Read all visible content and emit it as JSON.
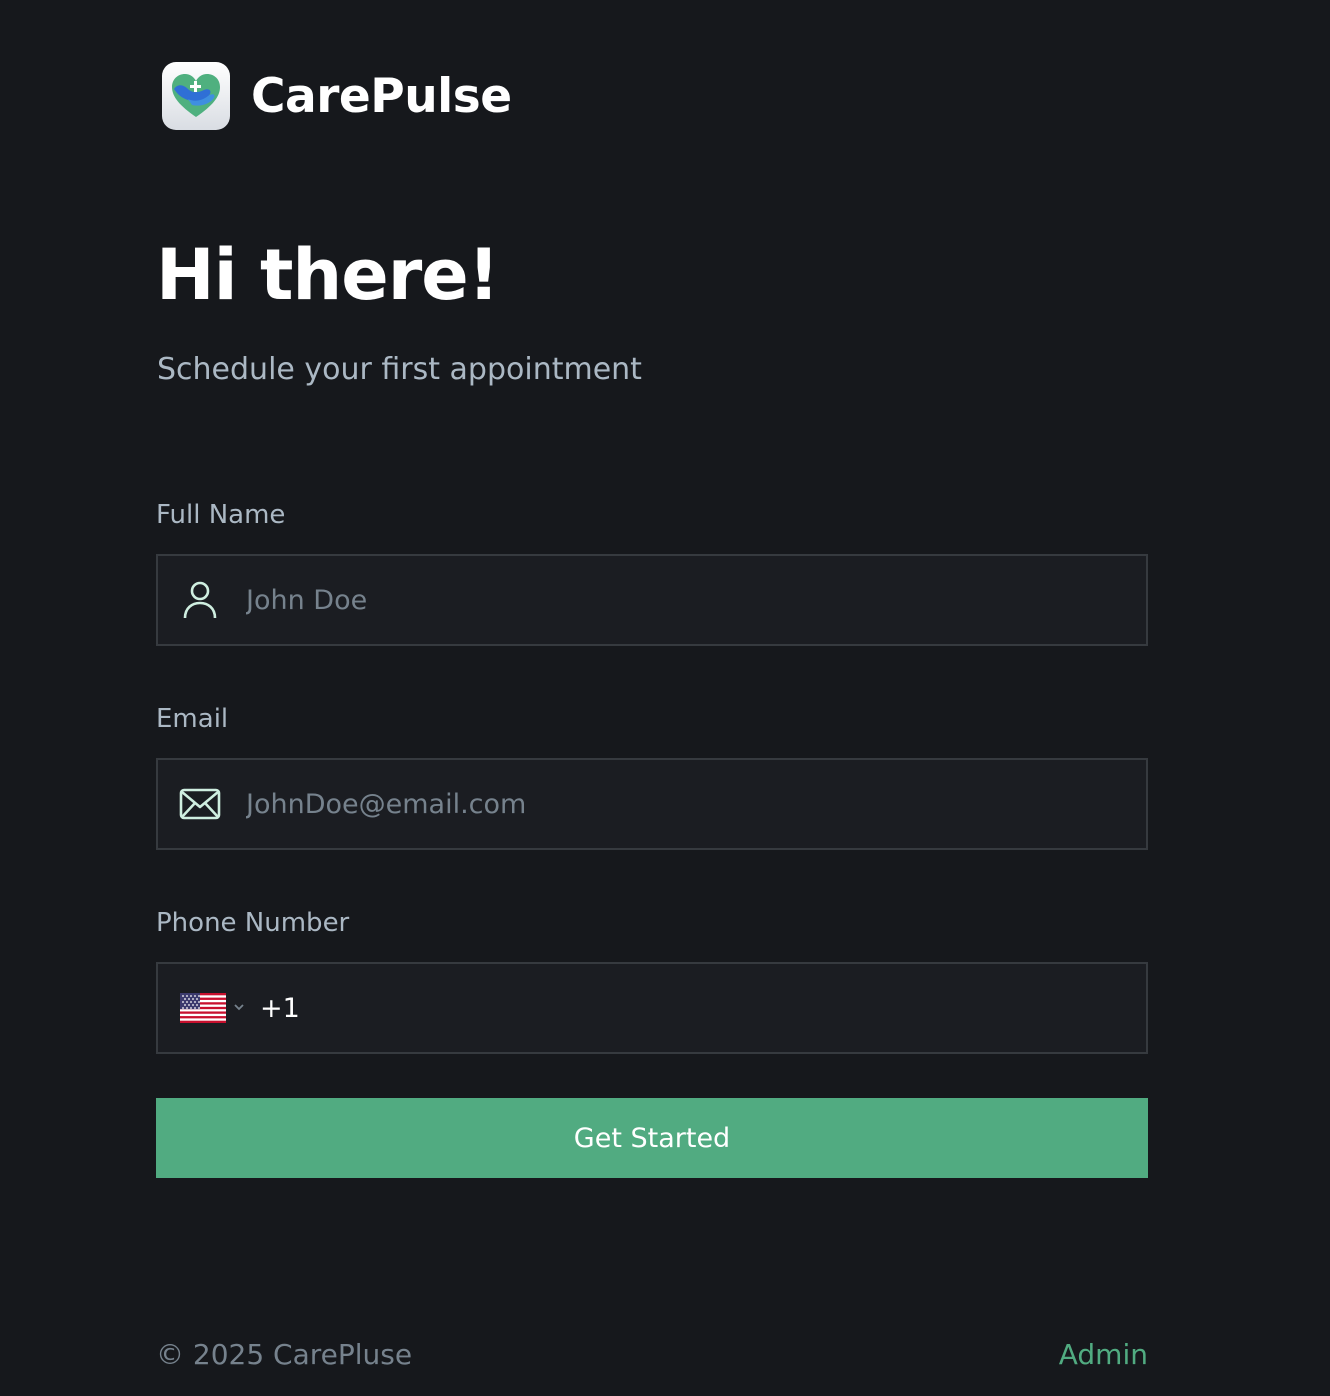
{
  "brand": {
    "name": "CarePulse",
    "logo_icon": "heart-hands-logo"
  },
  "hero": {
    "title": "Hi there!",
    "subtitle": "Schedule your first appointment"
  },
  "form": {
    "full_name": {
      "label": "Full Name",
      "placeholder": "John Doe",
      "value": "",
      "icon": "user-icon"
    },
    "email": {
      "label": "Email",
      "placeholder": "JohnDoe@email.com",
      "value": "",
      "icon": "mail-icon"
    },
    "phone": {
      "label": "Phone Number",
      "country_flag": "us-flag-icon",
      "dial_code": "+1",
      "value": ""
    },
    "submit_label": "Get Started"
  },
  "footer": {
    "copyright": "© 2025 CarePluse",
    "admin_label": "Admin"
  },
  "colors": {
    "background": "#16181c",
    "input_background": "#1b1d22",
    "input_border": "#363a3f",
    "accent": "#51ab81",
    "label": "#abb8c4",
    "placeholder": "#76828d"
  }
}
